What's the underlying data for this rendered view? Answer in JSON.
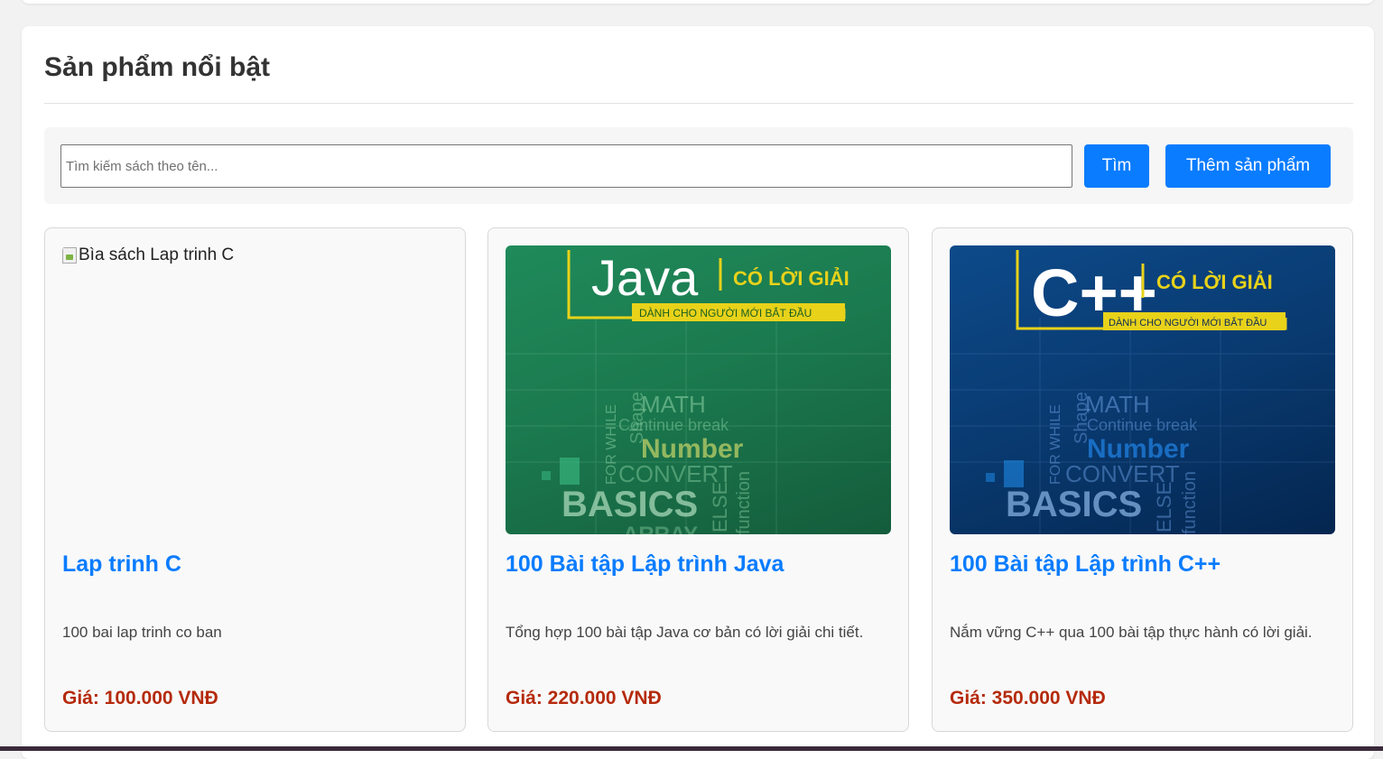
{
  "section": {
    "title": "Sản phẩm nổi bật"
  },
  "search": {
    "placeholder": "Tìm kiếm sách theo tên...",
    "search_label": "Tìm",
    "add_label": "Thêm sản phẩm"
  },
  "colors": {
    "accent": "#0a7cff",
    "price": "#b52a0c"
  },
  "products": [
    {
      "cover_alt": "Bìa sách Lap trinh C",
      "title": "Lap trinh C",
      "description": "100 bai lap trinh co ban",
      "price": "Giá: 100.000 VNĐ"
    },
    {
      "cover_alt": "100 Bài tập Lập trình Java",
      "cover_text": {
        "brand": "Java",
        "tag": "CÓ LỜI GIẢI",
        "sub": "DÀNH CHO NGƯỜI MỚI BẮT ĐẦU",
        "words": [
          "MATH",
          "Continue break",
          "Number",
          "CONVERT",
          "BASICS",
          "FOR WHILE",
          "Shape",
          "ELSE",
          "function",
          "ARRAY"
        ]
      },
      "title": "100 Bài tập Lập trình Java",
      "description": "Tổng hợp 100 bài tập Java cơ bản có lời giải chi tiết.",
      "price": "Giá: 220.000 VNĐ"
    },
    {
      "cover_alt": "100 Bài tập Lập trình C++",
      "cover_text": {
        "brand": "C++",
        "tag": "CÓ LỜI GIẢI",
        "sub": "DÀNH CHO NGƯỜI MỚI BẮT ĐẦU",
        "words": [
          "MATH",
          "Continue break",
          "Number",
          "CONVERT",
          "BASICS",
          "FOR WHILE",
          "Shape",
          "ELSE",
          "function"
        ]
      },
      "title": "100 Bài tập Lập trình C++",
      "description": "Nắm vững C++ qua 100 bài tập thực hành có lời giải.",
      "price": "Giá: 350.000 VNĐ"
    }
  ]
}
